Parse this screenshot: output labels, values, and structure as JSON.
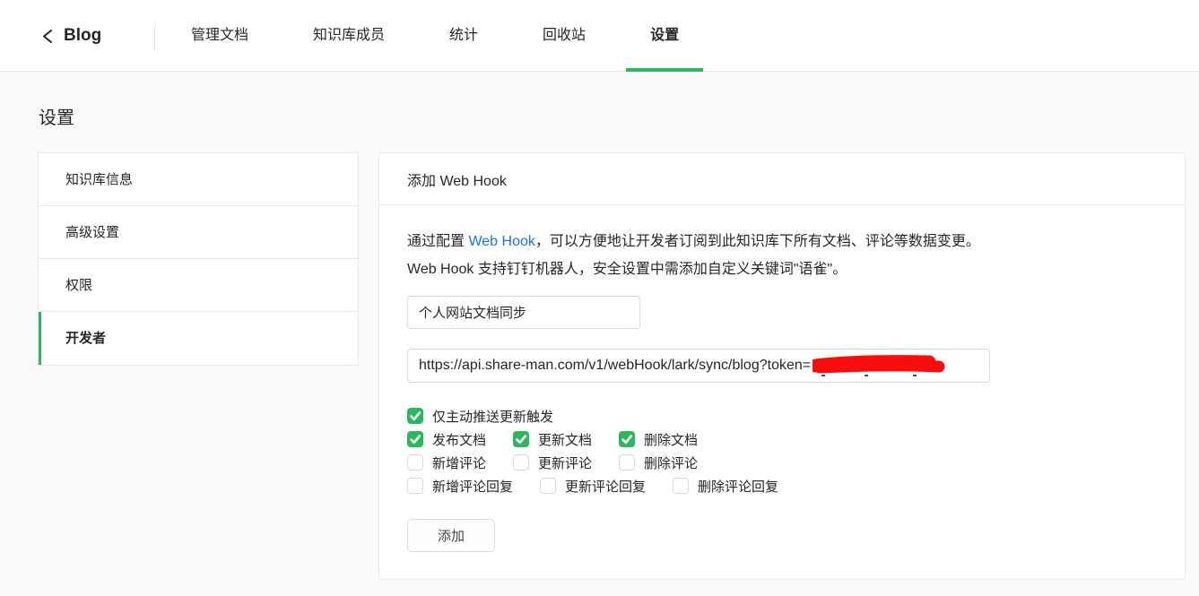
{
  "colors": {
    "accent_green": "#2bb85c",
    "link_blue": "#1b6fe0",
    "redaction_red": "#f60d0d"
  },
  "nav": {
    "back_label": "Blog",
    "tabs": [
      {
        "label": "管理文档",
        "active": false
      },
      {
        "label": "知识库成员",
        "active": false
      },
      {
        "label": "统计",
        "active": false
      },
      {
        "label": "回收站",
        "active": false
      },
      {
        "label": "设置",
        "active": true
      }
    ]
  },
  "page": {
    "title": "设置"
  },
  "sidebar": {
    "items": [
      {
        "label": "知识库信息",
        "active": false
      },
      {
        "label": "高级设置",
        "active": false
      },
      {
        "label": "权限",
        "active": false
      },
      {
        "label": "开发者",
        "active": true
      }
    ]
  },
  "panel": {
    "title": "添加 Web Hook",
    "description": {
      "pre": "通过配置 ",
      "link": "Web Hook",
      "post": "，可以方便地让开发者订阅到此知识库下所有文档、评论等数据变更。Web Hook 支持钉钉机器人，安全设置中需添加自定义关键词\"语雀\"。"
    },
    "name_input": {
      "value": "个人网站文档同步"
    },
    "url_input": {
      "value": "https://api.share-man.com/v1/webHook/lark/sync/blog?token=",
      "token_redacted": true
    },
    "checkbox_rows": [
      [
        {
          "label": "仅主动推送更新触发",
          "checked": true
        }
      ],
      [
        {
          "label": "发布文档",
          "checked": true
        },
        {
          "label": "更新文档",
          "checked": true
        },
        {
          "label": "删除文档",
          "checked": true
        }
      ],
      [
        {
          "label": "新增评论",
          "checked": false
        },
        {
          "label": "更新评论",
          "checked": false
        },
        {
          "label": "删除评论",
          "checked": false
        }
      ],
      [
        {
          "label": "新增评论回复",
          "checked": false
        },
        {
          "label": "更新评论回复",
          "checked": false
        },
        {
          "label": "删除评论回复",
          "checked": false
        }
      ]
    ],
    "add_button": "添加"
  }
}
